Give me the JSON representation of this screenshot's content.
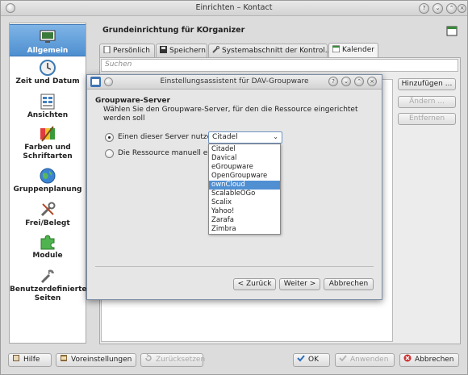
{
  "window": {
    "title": "Einrichten – Kontact"
  },
  "sidebar": {
    "items": [
      {
        "label": "Allgemein",
        "icon": "monitor-icon"
      },
      {
        "label": "Zeit und Datum",
        "icon": "clock-icon"
      },
      {
        "label": "Ansichten",
        "icon": "views-icon"
      },
      {
        "label": "Farben und Schriftarten",
        "icon": "palette-icon"
      },
      {
        "label": "Gruppenplanung",
        "icon": "globe-icon"
      },
      {
        "label": "Frei/Belegt",
        "icon": "tools-icon"
      },
      {
        "label": "Module",
        "icon": "puzzle-icon"
      },
      {
        "label": "Benutzerdefinierte Seiten",
        "icon": "wrench-icon"
      }
    ]
  },
  "panel": {
    "title": "Grundeinrichtung für KOrganizer",
    "tabs": [
      {
        "label": "Persönlich"
      },
      {
        "label": "Speichern"
      },
      {
        "label": "Systemabschnitt der Kontrol..."
      },
      {
        "label": "Kalender"
      }
    ],
    "search_placeholder": "Suchen",
    "buttons": {
      "add": "Hinzufügen ...",
      "edit": "Ändern ...",
      "remove": "Entfernen"
    }
  },
  "footer": {
    "help": "Hilfe",
    "defaults": "Voreinstellungen",
    "reset": "Zurücksetzen",
    "ok": "OK",
    "apply": "Anwenden",
    "cancel": "Abbrechen"
  },
  "dialog": {
    "title": "Einstellungsassistent für DAV-Groupware",
    "heading": "Groupware-Server",
    "description": "Wählen Sie den Groupware-Server, für den die Ressource eingerichtet werden soll",
    "option_server": "Einen dieser Server nutzen:",
    "option_manual": "Die Ressource manuell einric",
    "selected_server": "Citadel",
    "servers": [
      "Citadel",
      "Davical",
      "eGroupware",
      "OpenGroupware",
      "ownCloud",
      "ScalableOGo",
      "Scalix",
      "Yahoo!",
      "Zarafa",
      "Zimbra"
    ],
    "highlighted_server": "ownCloud",
    "back": "< Zurück",
    "next": "Weiter >",
    "cancel": "Abbrechen"
  },
  "colors": {
    "selection": "#4f8fd2",
    "sidebar_active": "#5a9ad8"
  }
}
